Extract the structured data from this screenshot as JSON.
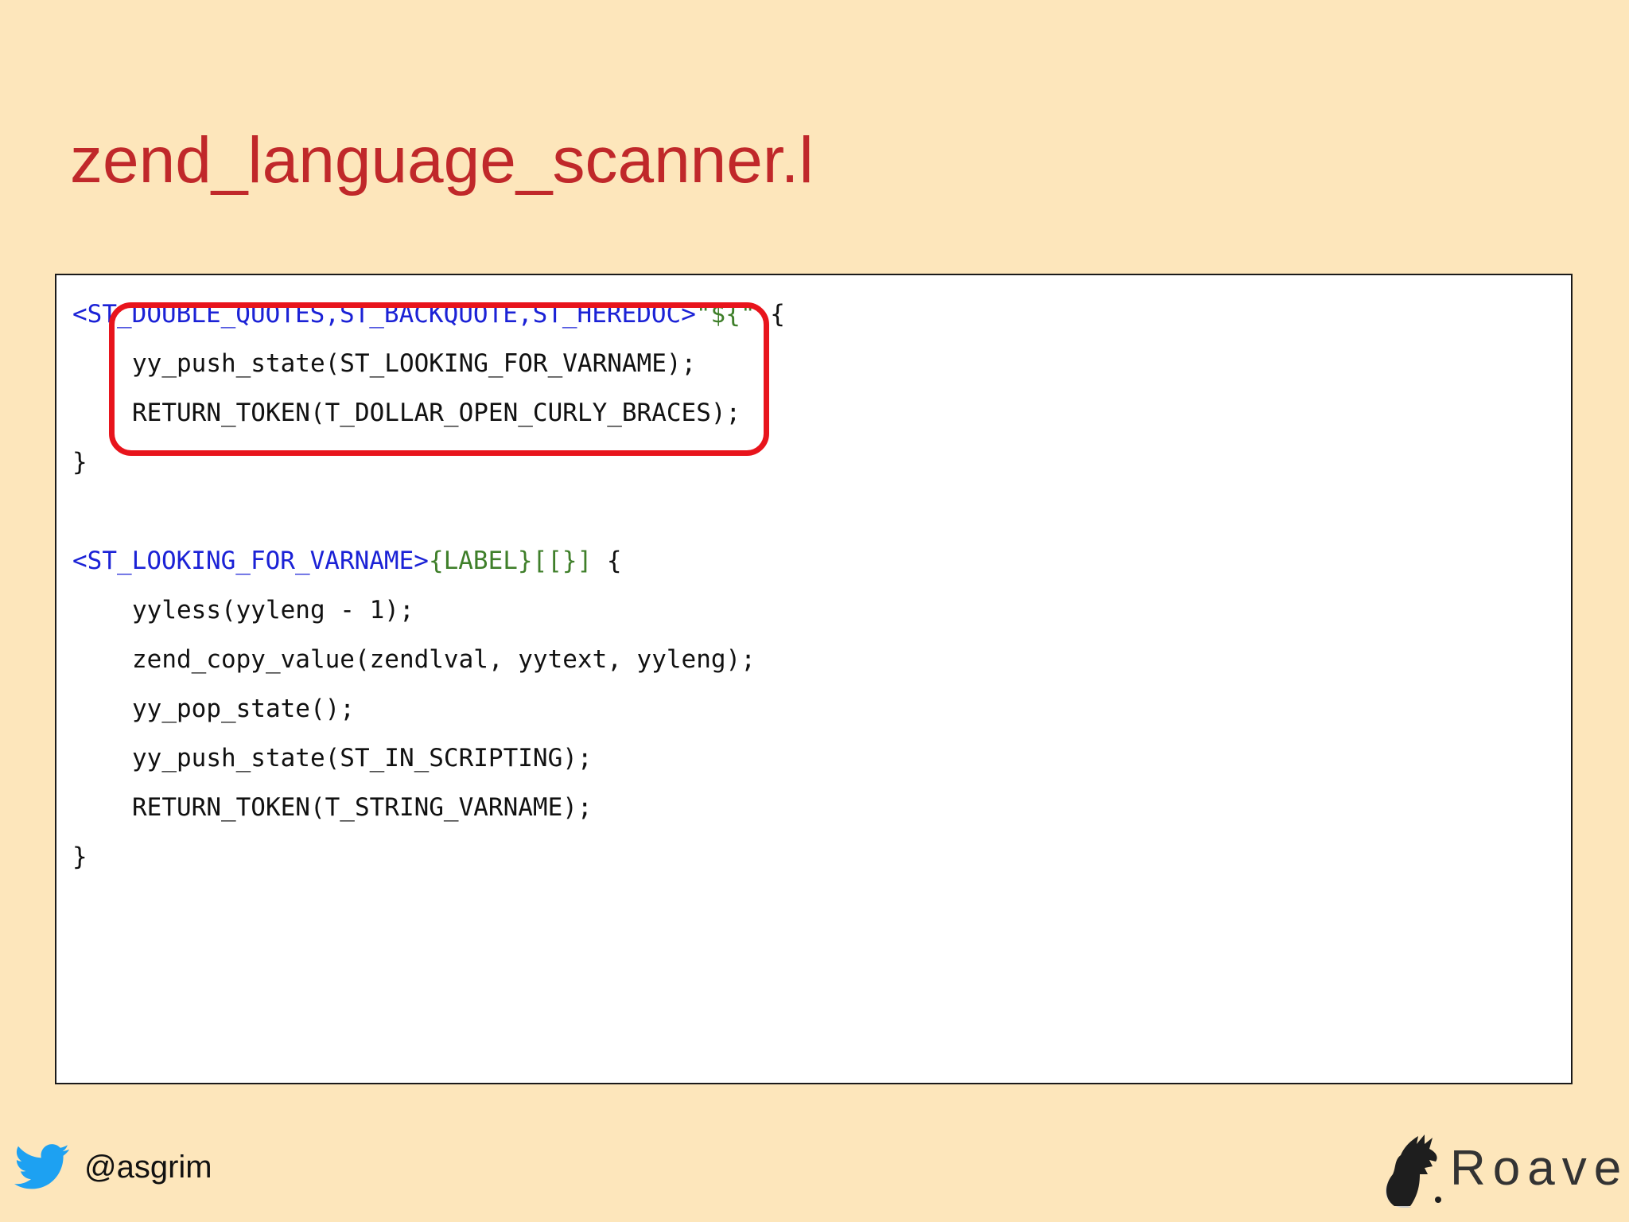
{
  "slide": {
    "title": "zend_language_scanner.l"
  },
  "code": {
    "rule1": {
      "state_open": "<ST_DOUBLE_QUOTES,ST_BACKQUOTE,ST_HEREDOC>",
      "pattern": "\"${\"",
      "brace_open": " {",
      "line1": "yy_push_state(ST_LOOKING_FOR_VARNAME);",
      "line2": "RETURN_TOKEN(T_DOLLAR_OPEN_CURLY_BRACES);",
      "brace_close": "}"
    },
    "rule2": {
      "state_open": "<ST_LOOKING_FOR_VARNAME>",
      "pattern": "{LABEL}[[}]",
      "brace_open": " {",
      "line1": "yyless(yyleng - 1);",
      "line2": "zend_copy_value(zendlval, yytext, yyleng);",
      "line3": "yy_pop_state();",
      "line4": "yy_push_state(ST_IN_SCRIPTING);",
      "line5": "RETURN_TOKEN(T_STRING_VARNAME);",
      "brace_close": "}"
    }
  },
  "footer": {
    "twitter_handle": "@asgrim",
    "brand_name": "Roave"
  },
  "colors": {
    "background": "#fde6bb",
    "title": "#c0282a",
    "state_blue": "#1b22d6",
    "pattern_green": "#3f7f2a",
    "highlight_red": "#e8141c",
    "twitter_blue": "#1da1f2"
  },
  "icons": {
    "twitter": "twitter-bird-icon",
    "brand_logo": "roave-logo-icon"
  }
}
